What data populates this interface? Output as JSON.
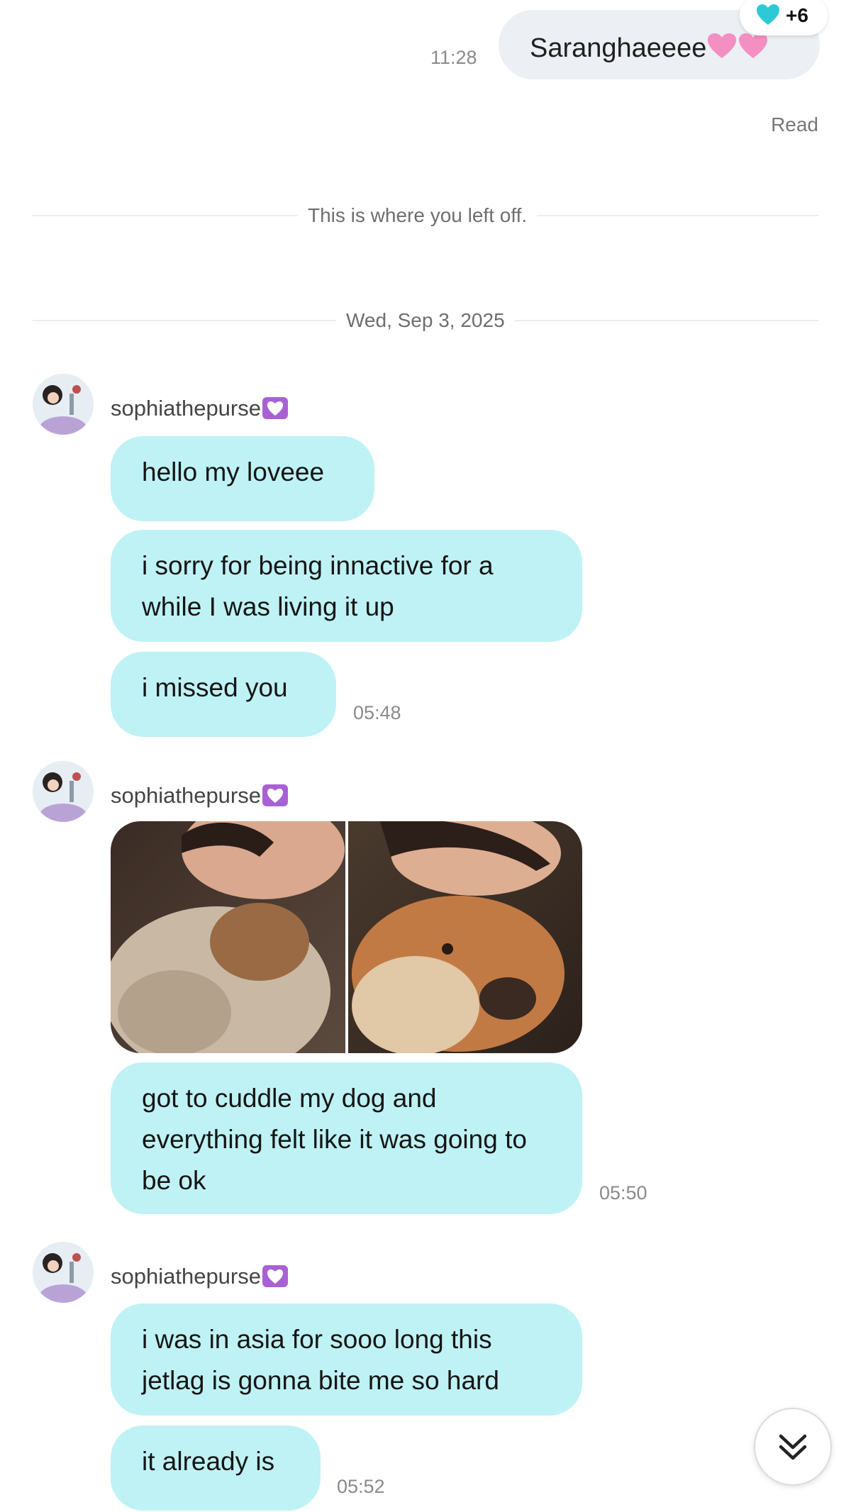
{
  "outgoing": {
    "text": "Saranghaeeee",
    "time": "11:28",
    "reaction_count": "+6",
    "read_label": "Read"
  },
  "dividers": {
    "left_off": "This is where you left off.",
    "date": "Wed, Sep 3, 2025"
  },
  "groups": [
    {
      "username": "sophiathepurse",
      "messages": [
        "hello my loveee",
        "i sorry for being innactive for a while I was living it up",
        "i missed you"
      ],
      "time": "05:48"
    },
    {
      "username": "sophiathepurse",
      "messages": [
        "got to cuddle my dog and everything felt like it was going to be ok"
      ],
      "time": "05:50"
    },
    {
      "username": "sophiathepurse",
      "messages": [
        "i was in asia for sooo long this jetlag is gonna bite me so hard",
        "it already is"
      ],
      "time": "05:52"
    }
  ],
  "icons": {
    "reaction": "cyan-heart-icon",
    "username_badge": "purple-heart-icon",
    "scroll": "double-chevron-down-icon"
  },
  "colors": {
    "incoming_bubble": "#bff2f5",
    "outgoing_bubble": "#eceff3",
    "badge": "#a861d4"
  }
}
